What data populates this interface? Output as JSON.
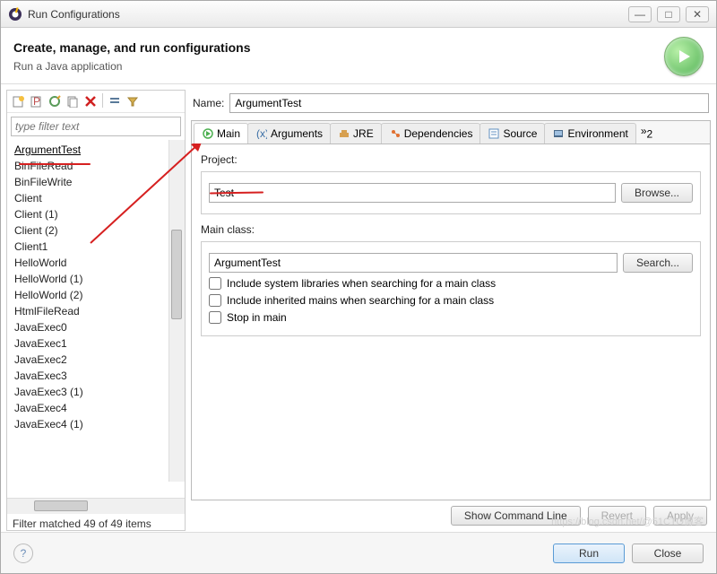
{
  "window": {
    "title": "Run Configurations"
  },
  "header": {
    "title": "Create, manage, and run configurations",
    "subtitle": "Run a Java application"
  },
  "filter": {
    "placeholder": "type filter text",
    "status": "Filter matched 49 of 49 items"
  },
  "tree": {
    "items": [
      "ArgumentTest",
      "BinFileRead",
      "BinFileWrite",
      "Client",
      "Client (1)",
      "Client (2)",
      "Client1",
      "HelloWorld",
      "HelloWorld (1)",
      "HelloWorld (2)",
      "HtmlFileRead",
      "JavaExec0",
      "JavaExec1",
      "JavaExec2",
      "JavaExec3",
      "JavaExec3 (1)",
      "JavaExec4",
      "JavaExec4 (1)"
    ]
  },
  "form": {
    "name_label": "Name:",
    "name_value": "ArgumentTest",
    "tabs": [
      "Main",
      "Arguments",
      "JRE",
      "Dependencies",
      "Source",
      "Environment"
    ],
    "tabs_more": "2",
    "project_label": "Project:",
    "project_value": "Test",
    "browse": "Browse...",
    "mainclass_label": "Main class:",
    "mainclass_value": "ArgumentTest",
    "search": "Search...",
    "chk1": "Include system libraries when searching for a main class",
    "chk2": "Include inherited mains when searching for a main class",
    "chk3": "Stop in main"
  },
  "actions": {
    "cmdline": "Show Command Line",
    "revert": "Revert",
    "apply": "Apply"
  },
  "footer": {
    "run": "Run",
    "close": "Close"
  },
  "watermark": "https://blog.csdn.net/@51CTO博客"
}
